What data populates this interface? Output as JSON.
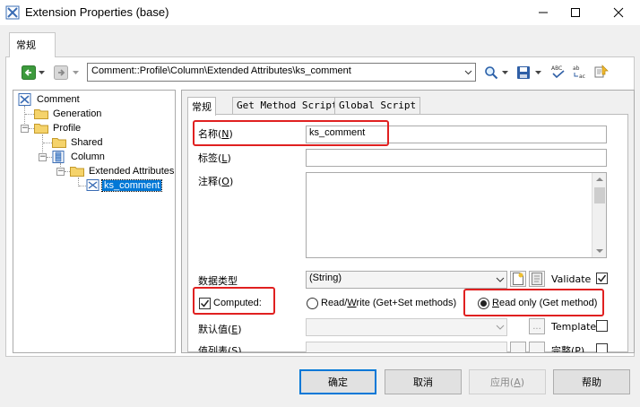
{
  "window": {
    "title": "Extension Properties (base)"
  },
  "outer_tab": {
    "label": "常规"
  },
  "toolbar": {
    "path": "Comment::Profile\\Column\\Extended Attributes\\ks_comment"
  },
  "tree": {
    "items": [
      {
        "label": "Comment"
      },
      {
        "label": "Generation"
      },
      {
        "label": "Profile"
      },
      {
        "label": "Shared"
      },
      {
        "label": "Column"
      },
      {
        "label": "Extended Attributes"
      },
      {
        "label": "ks_comment"
      }
    ]
  },
  "inner_tabs": [
    {
      "label": "常规"
    },
    {
      "label": "Get Method Script"
    },
    {
      "label": "Global Script"
    }
  ],
  "form": {
    "name_label": "名称(",
    "name_mnemonic": "N",
    "name_value": "ks_comment",
    "code_label": "标签(",
    "code_mnemonic": "L",
    "code_value": "",
    "comment_label": "注释(",
    "comment_mnemonic": "O",
    "comment_value": "",
    "datatype_label": "数据类型",
    "datatype_value": "(String)",
    "validate_label": "Validate",
    "computed_label": "Computed:",
    "readwrite_label_pre": "Read/",
    "readwrite_mnemonic": "W",
    "readwrite_label_post": "rite (Get+Set methods)",
    "readonly_mnemonic": "R",
    "readonly_label_post": "ead only (Get method)",
    "default_label": "默认值(",
    "default_mnemonic": "E",
    "default_value": "",
    "template_label": "Template",
    "ellipsis": "...",
    "cut_label_left": "值列表(S)",
    "cut_label_right": "完整(P)"
  },
  "checkboxes": {
    "validate": true,
    "computed": true,
    "template": false
  },
  "buttons": {
    "ok": "确定",
    "cancel": "取消",
    "apply": "应用(",
    "apply_mnemonic": "A",
    "help": "帮助"
  },
  "colors": {
    "highlight_box": "#e02020",
    "selection": "#0078d7"
  }
}
